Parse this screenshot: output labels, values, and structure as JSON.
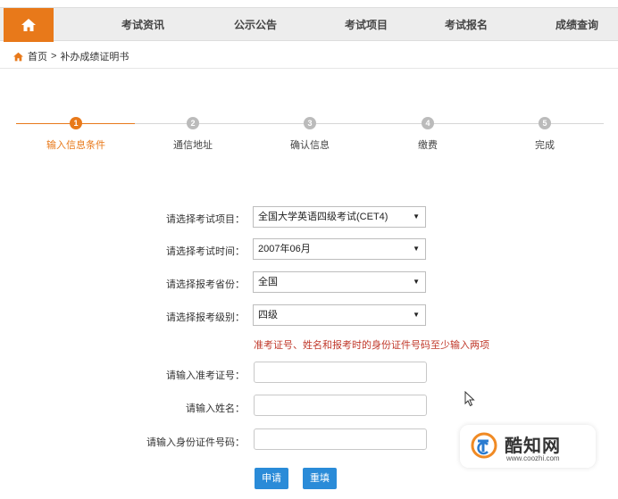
{
  "nav": {
    "items": [
      "考试资讯",
      "公示公告",
      "考试项目",
      "考试报名",
      "成绩查询"
    ]
  },
  "breadcrumb": {
    "home": "首页",
    "separator": ">",
    "current": "补办成绩证明书"
  },
  "steps": [
    {
      "number": "1",
      "label": "输入信息条件",
      "active": true
    },
    {
      "number": "2",
      "label": "通信地址",
      "active": false
    },
    {
      "number": "3",
      "label": "确认信息",
      "active": false
    },
    {
      "number": "4",
      "label": "缴费",
      "active": false
    },
    {
      "number": "5",
      "label": "完成",
      "active": false
    }
  ],
  "form": {
    "exam_project_label": "请选择考试项目：",
    "exam_project_value": "全国大学英语四级考试(CET4)",
    "exam_time_label": "请选择考试时间：",
    "exam_time_value": "2007年06月",
    "province_label": "请选择报考省份：",
    "province_value": "全国",
    "level_label": "请选择报考级别：",
    "level_value": "四级",
    "notice": "准考证号、姓名和报考时的身份证件号码至少输入两项",
    "ticket_label": "请输入准考证号：",
    "name_label": "请输入姓名：",
    "id_label": "请输入身份证件号码：",
    "submit": "申请",
    "reset": "重填"
  },
  "watermark": {
    "title": "酷知网",
    "url": "www.coozhi.com"
  },
  "colors": {
    "accent": "#e8791a",
    "button": "#2a8bd8",
    "notice": "#c0392b",
    "inactive": "#bbbbbb"
  },
  "icons": {
    "home": "home-icon",
    "breadcrumb_home": "home-icon",
    "select_arrow": "triangle-down-icon",
    "cursor": "mouse-pointer-icon"
  }
}
